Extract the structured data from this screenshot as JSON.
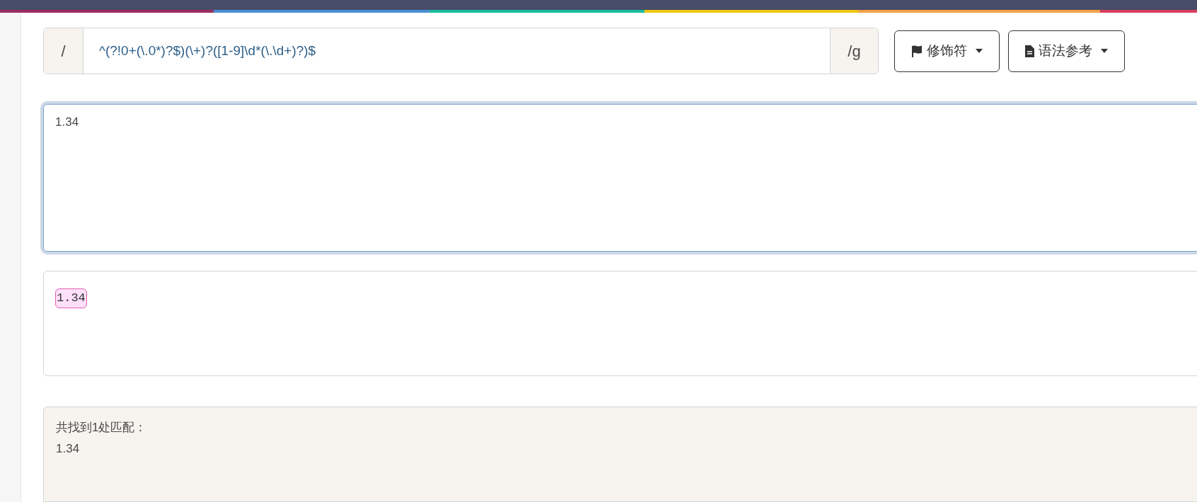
{
  "regex_bar": {
    "prefix": "/",
    "pattern": "^(?!0+(\\.0*)?$)(\\+)?([1-9]\\d*(\\.\\d+)?)$",
    "suffix": "/g"
  },
  "buttons": [
    {
      "label": "修饰符",
      "kind": "flag"
    },
    {
      "label": "语法参考",
      "kind": "document"
    }
  ],
  "test_input": {
    "value": "1.34",
    "focused": true
  },
  "highlighted_result": [
    {
      "text": "1.34",
      "match": true
    }
  ],
  "match_panel": {
    "summary": "共找到1处匹配：",
    "matches": [
      "1.34"
    ]
  }
}
